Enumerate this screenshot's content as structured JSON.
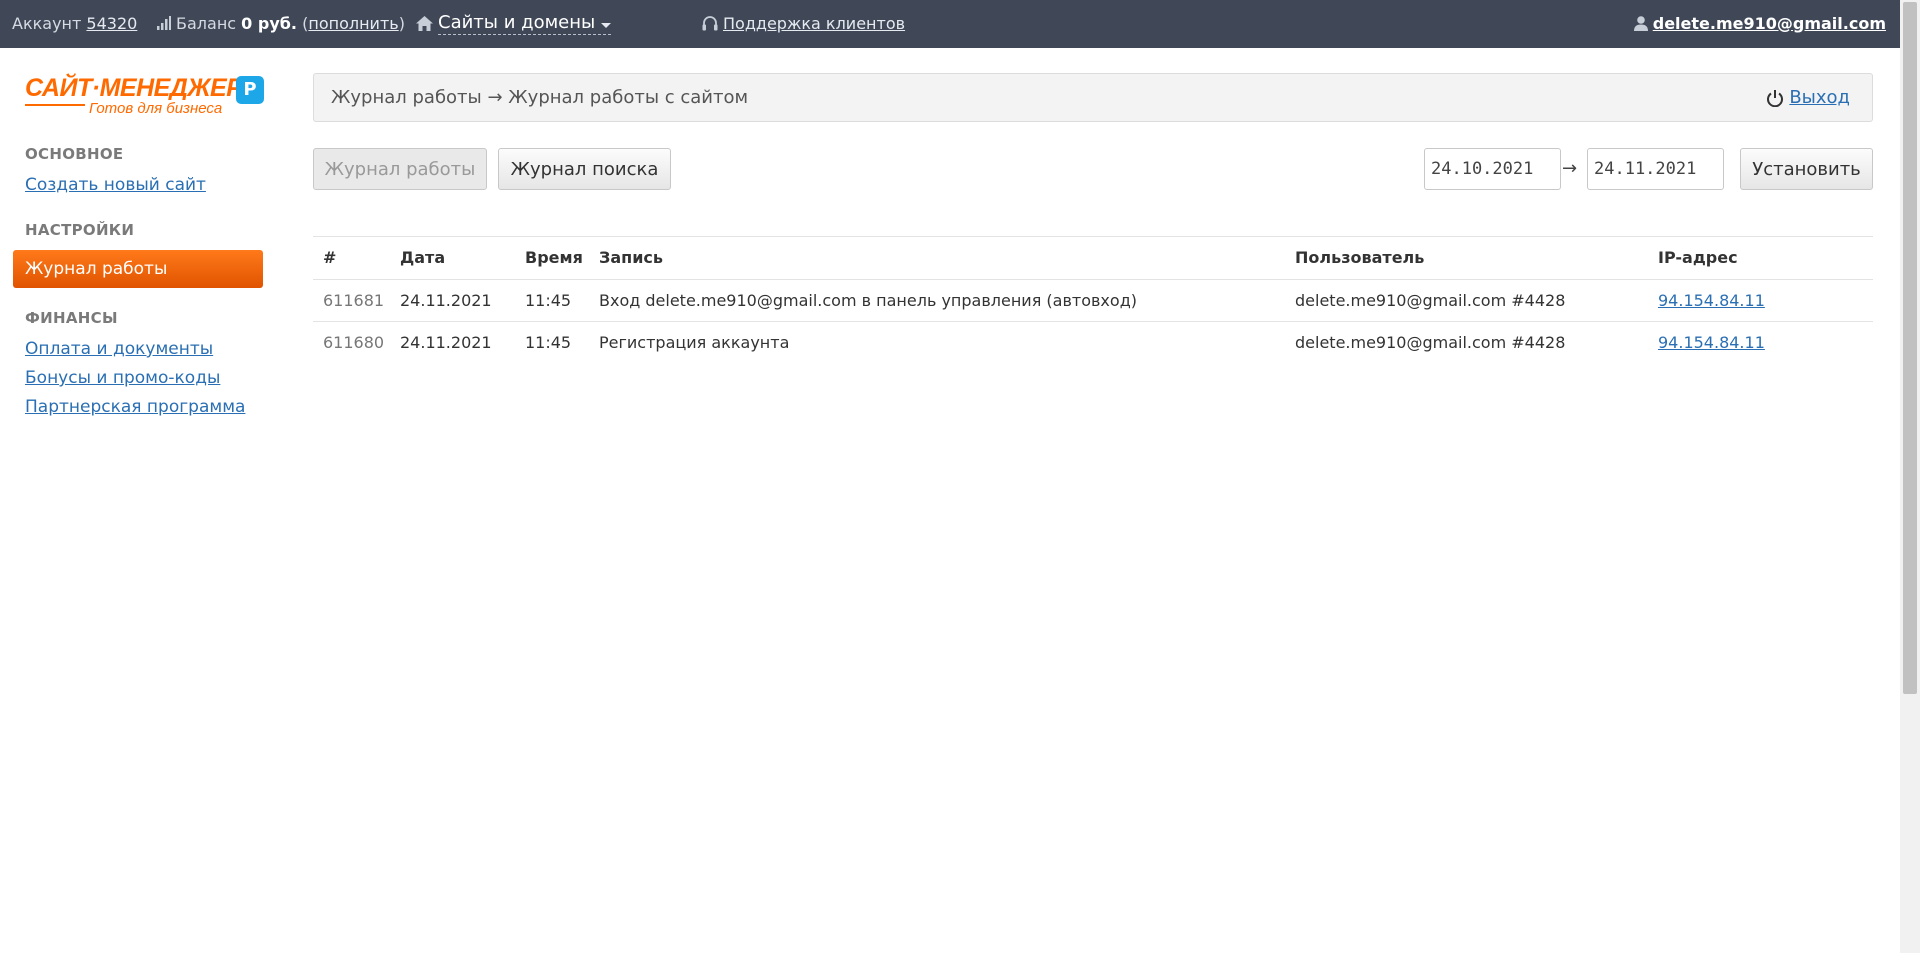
{
  "topbar": {
    "account_label": "Аккаунт",
    "account_number": "54320",
    "balance_label": "Баланс",
    "balance_value": "0 руб.",
    "topup_open": "(",
    "topup_link": "пополнить",
    "topup_close": ")",
    "sites_menu": "Сайты и домены",
    "support_link": "Поддержка клиентов",
    "user_email": "delete.me910@gmail.com"
  },
  "logo": {
    "title": "САЙТ·МЕНЕДЖЕР",
    "subtitle": "Готов для бизнеса",
    "badge": "P"
  },
  "sidebar": {
    "section_main": "ОСНОВНОЕ",
    "create_site": "Создать новый сайт",
    "section_settings": "НАСТРОЙКИ",
    "work_log": "Журнал работы",
    "section_finance": "ФИНАНСЫ",
    "payments": "Оплата и документы",
    "bonuses": "Бонусы и промо-коды",
    "partners": "Партнерская программа"
  },
  "breadcrumb": {
    "text": "Журнал работы → Журнал работы с сайтом",
    "logout": "Выход"
  },
  "toolbar": {
    "work_log_button": "Журнал работы",
    "search_log_button": "Журнал поиска",
    "date_from": "24.10.2021",
    "arrow": "→",
    "date_to": "24.11.2021",
    "apply_button": "Установить"
  },
  "table": {
    "headers": {
      "id": "#",
      "date": "Дата",
      "time": "Время",
      "record": "Запись",
      "user": "Пользователь",
      "ip": "IP-адрес"
    },
    "rows": [
      {
        "id": "611681",
        "date": "24.11.2021",
        "time": "11:45",
        "record": "Вход delete.me910@gmail.com в панель управления (автовход)",
        "user": "delete.me910@gmail.com #4428",
        "ip": "94.154.84.11"
      },
      {
        "id": "611680",
        "date": "24.11.2021",
        "time": "11:45",
        "record": "Регистрация аккаунта",
        "user": "delete.me910@gmail.com #4428",
        "ip": "94.154.84.11"
      }
    ]
  }
}
